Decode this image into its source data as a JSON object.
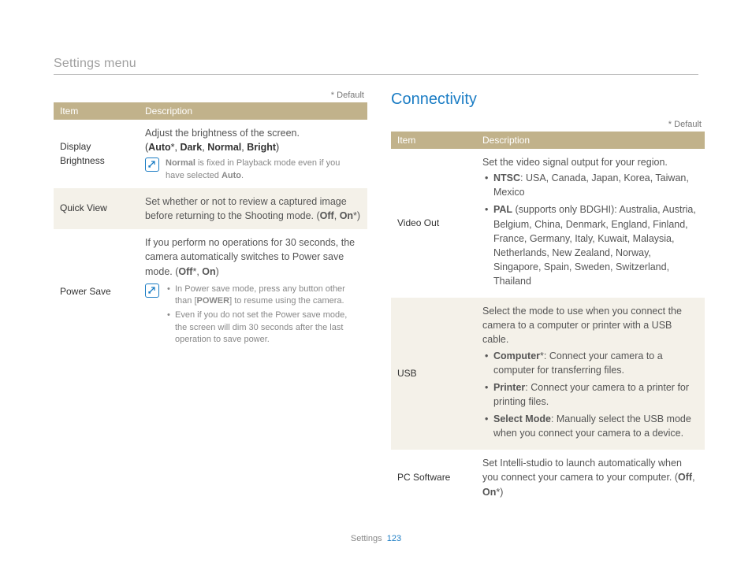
{
  "header": {
    "title": "Settings menu"
  },
  "default_label": "* Default",
  "table_headers": {
    "item": "Item",
    "description": "Description"
  },
  "left_table": {
    "rows": [
      {
        "item": "Display Brightness",
        "desc_intro": "Adjust the brightness of the screen.",
        "options_line": "(<b>Auto</b>*, <b>Dark</b>, <b>Normal</b>, <b>Bright</b>)",
        "note": "<b>Normal</b> is fixed in Playback mode even if you have selected <b>Auto</b>."
      },
      {
        "item": "Quick View",
        "desc": "Set whether or not to review a captured image before returning to the Shooting mode. (<b>Off</b>, <b>On</b>*)"
      },
      {
        "item": "Power Save",
        "desc_intro": "If you perform no operations for 30 seconds, the camera automatically switches to Power save mode. (<b>Off</b>*, <b>On</b>)",
        "notes": [
          "In Power save mode, press any button other than [<b>POWER</b>] to resume using the camera.",
          "Even if you do not set the Power save mode, the screen will dim 30 seconds after the last operation to save power."
        ]
      }
    ]
  },
  "right_section": {
    "heading": "Connectivity",
    "rows": [
      {
        "item": "Video Out",
        "desc_intro": "Set the video signal output for your region.",
        "bullets": [
          "<b>NTSC</b>: USA, Canada, Japan, Korea, Taiwan, Mexico",
          "<b>PAL</b> (supports only BDGHI): Australia, Austria, Belgium, China, Denmark, England, Finland, France, Germany, Italy, Kuwait, Malaysia, Netherlands, New Zealand, Norway, Singapore, Spain, Sweden, Switzerland, Thailand"
        ]
      },
      {
        "item": "USB",
        "desc_intro": "Select the mode to use when you connect the camera to a computer or printer with a USB cable.",
        "bullets": [
          "<b>Computer</b>*: Connect your camera to a computer for transferring files.",
          "<b>Printer</b>: Connect your camera to a printer for printing files.",
          "<b>Select Mode</b>: Manually select the USB mode when you connect your camera to a device."
        ]
      },
      {
        "item": "PC Software",
        "desc": "Set Intelli-studio to launch automatically when you connect your camera to your computer. (<b>Off</b>, <b>On</b>*)"
      }
    ]
  },
  "footer": {
    "section": "Settings",
    "page": "123"
  }
}
